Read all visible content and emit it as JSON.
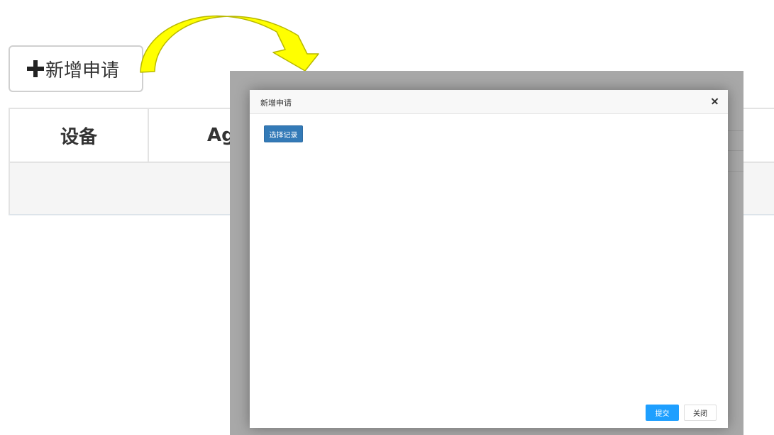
{
  "background": {
    "add_button_label": "新增申请",
    "table_headers": [
      "设备",
      "Ag"
    ]
  },
  "modal": {
    "title": "新增申请",
    "select_button_label": "选择记录",
    "submit_button_label": "提交",
    "close_button_label": "关闭"
  },
  "icons": {
    "add": "plus-icon",
    "close": "close-icon",
    "annotation": "curved-arrow-icon"
  },
  "colors": {
    "arrow_fill": "#ffff00",
    "arrow_stroke": "#b8b800",
    "primary_button": "#337ab7",
    "submit_button": "#1e9fff",
    "overlay": "#a8a8a8"
  }
}
